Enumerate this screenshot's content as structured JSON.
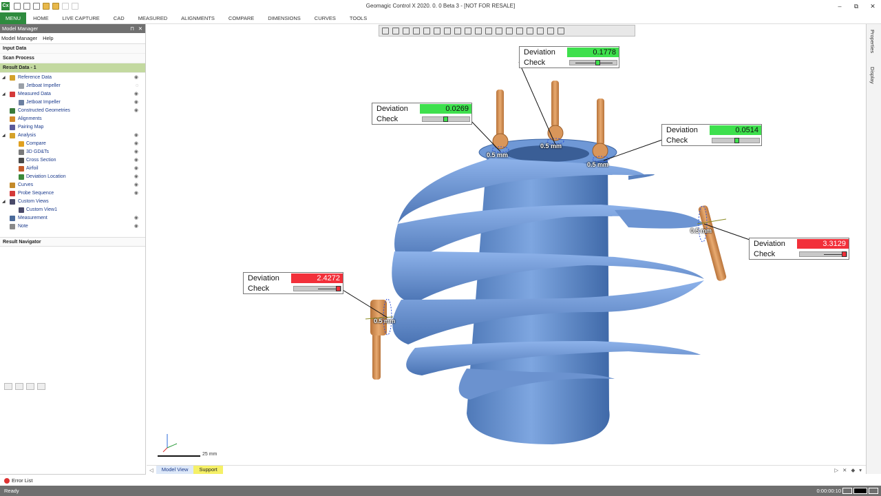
{
  "titlebar": {
    "app_icon": "Cx",
    "title": "Geomagic Control X 2020. 0. 0 Beta 3 - [NOT FOR RESALE]",
    "minimize": "–",
    "restore": "⧉",
    "close": "✕"
  },
  "menubar": {
    "menu_label": "MENU",
    "items": [
      "HOME",
      "LIVE CAPTURE",
      "CAD",
      "MEASURED",
      "ALIGNMENTS",
      "COMPARE",
      "DIMENSIONS",
      "CURVES",
      "TOOLS"
    ]
  },
  "model_manager": {
    "header": "Model Manager",
    "pin": "⊓",
    "close": "✕",
    "tabs": [
      "Model Manager",
      "Help"
    ],
    "sections": {
      "input_data": "Input Data",
      "scan_process": "Scan Process",
      "result_data": "Result Data - 1",
      "result_navigator": "Result Navigator"
    },
    "tree": [
      {
        "label": "Reference Data",
        "level": 1,
        "arrow": "◢",
        "icon": "reference-data-icon",
        "color": "#d4a12a",
        "eye": "◉"
      },
      {
        "label": "Jetboat Impeller",
        "level": 2,
        "arrow": "",
        "icon": "cad-body-icon",
        "color": "#9aa0a8",
        "eye": "◌"
      },
      {
        "label": "Measured Data",
        "level": 1,
        "arrow": "◢",
        "icon": "measured-data-icon",
        "color": "#d43a3a",
        "eye": "◉"
      },
      {
        "label": "Jetboat Impeller",
        "level": 2,
        "arrow": "",
        "icon": "mesh-icon",
        "color": "#6b7fa0",
        "eye": "◉"
      },
      {
        "label": "Constructed Geometries",
        "level": 1,
        "arrow": "",
        "icon": "geometry-icon",
        "color": "#3a7a3a",
        "eye": "◉"
      },
      {
        "label": "Alignments",
        "level": 1,
        "arrow": "",
        "icon": "alignment-icon",
        "color": "#d48a2a",
        "eye": ""
      },
      {
        "label": "Pairing Map",
        "level": 1,
        "arrow": "",
        "icon": "pairing-map-icon",
        "color": "#5a5a9a",
        "eye": ""
      },
      {
        "label": "Analysis",
        "level": 1,
        "arrow": "◢",
        "icon": "analysis-icon",
        "color": "#d4a12a",
        "eye": "◉"
      },
      {
        "label": "Compare",
        "level": 2,
        "arrow": "",
        "icon": "compare-icon",
        "color": "#e0a020",
        "eye": "◉"
      },
      {
        "label": "3D GD&Ts",
        "level": 2,
        "arrow": "",
        "icon": "gdt-icon",
        "color": "#7a7a7a",
        "eye": "◉"
      },
      {
        "label": "Cross Section",
        "level": 2,
        "arrow": "",
        "icon": "cross-section-icon",
        "color": "#4a4a4a",
        "eye": "◉"
      },
      {
        "label": "Airfoil",
        "level": 2,
        "arrow": "",
        "icon": "airfoil-icon",
        "color": "#c45a2a",
        "eye": "◉"
      },
      {
        "label": "Deviation Location",
        "level": 2,
        "arrow": "",
        "icon": "deviation-location-icon",
        "color": "#3a8a3a",
        "eye": "◉"
      },
      {
        "label": "Curves",
        "level": 1,
        "arrow": "",
        "icon": "curves-icon",
        "color": "#c48a2a",
        "eye": "◉"
      },
      {
        "label": "Probe Sequence",
        "level": 1,
        "arrow": "",
        "icon": "probe-sequence-icon",
        "color": "#d43a3a",
        "eye": "◉"
      },
      {
        "label": "Custom Views",
        "level": 1,
        "arrow": "◢",
        "icon": "custom-views-icon",
        "color": "#4a4a6a",
        "eye": ""
      },
      {
        "label": "Custom View1",
        "level": 2,
        "arrow": "",
        "icon": "camera-icon",
        "color": "#4a4a6a",
        "eye": ""
      },
      {
        "label": "Measurement",
        "level": 1,
        "arrow": "",
        "icon": "measurement-icon",
        "color": "#4a6a9a",
        "eye": "◉"
      },
      {
        "label": "Note",
        "level": 1,
        "arrow": "",
        "icon": "note-icon",
        "color": "#8a8a8a",
        "eye": "◉"
      }
    ]
  },
  "error_list": {
    "label": "Error List"
  },
  "viewport": {
    "callouts": [
      {
        "id": "c1",
        "deviation_label": "Deviation",
        "deviation_value": "0.1778",
        "check_label": "Check",
        "status": "good",
        "marker_pct": 56
      },
      {
        "id": "c2",
        "deviation_label": "Deviation",
        "deviation_value": "0.0269",
        "check_label": "Check",
        "status": "good",
        "marker_pct": 45
      },
      {
        "id": "c3",
        "deviation_label": "Deviation",
        "deviation_value": "0.0514",
        "check_label": "Check",
        "status": "good",
        "marker_pct": 48
      },
      {
        "id": "c4",
        "deviation_label": "Deviation",
        "deviation_value": "3.3129",
        "check_label": "Check",
        "status": "bad",
        "marker_pct": 92
      },
      {
        "id": "c5",
        "deviation_label": "Deviation",
        "deviation_value": "2.4272",
        "check_label": "Check",
        "status": "bad",
        "marker_pct": 92
      }
    ],
    "probe_labels": [
      "0.5 mm",
      "0.5 mm",
      "0.5 mm",
      "0.5 mm",
      "0.5 mm"
    ],
    "scale_label": "25 mm"
  },
  "viewport_tabs": {
    "tabs": [
      "Model View",
      "Support"
    ],
    "left_nav": "◁",
    "right_nav": [
      "▷",
      "✕",
      "◆",
      "▾"
    ]
  },
  "right_panel": {
    "labels": [
      "Properties",
      "Display"
    ]
  },
  "statusbar": {
    "status": "Ready",
    "time": "0:00:00:10"
  },
  "colors": {
    "accent": "#2e8b3e",
    "result_section": "#c3d9a0",
    "deviation_good": "#3ee04d",
    "deviation_bad": "#f2303a",
    "model_blue": "#6e98d6",
    "probe_orange": "#d9965a"
  }
}
